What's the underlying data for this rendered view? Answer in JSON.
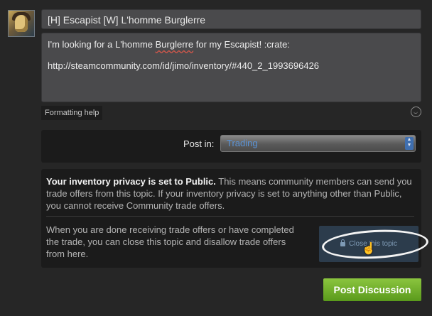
{
  "user": {
    "avatar_icon": "user-avatar"
  },
  "compose": {
    "title_value": "[H] Escapist [W] L'homme Burglerre",
    "body_line1_pre": "I'm looking for a L'homme ",
    "body_line1_misspelled": "Burglerre",
    "body_line1_post": " for my Escapist! :crate:",
    "body_line2": "http://steamcommunity.com/id/jimo/inventory/#440_2_1993696426",
    "formatting_help": "Formatting help",
    "emoticon_icon": "smiley-icon"
  },
  "post_in": {
    "label": "Post in:",
    "selected": "Trading"
  },
  "privacy": {
    "bold": "Your inventory privacy is set to Public.",
    "rest": " This means community members can send you trade offers from this topic. If your inventory privacy is set to anything other than Public, you cannot receive Community trade offers.",
    "close_text": "When you are done receiving trade offers or have completed the trade, you can close this topic and disallow trade offers from here.",
    "close_button": "Close this topic"
  },
  "actions": {
    "submit_label": "Post Discussion"
  },
  "colors": {
    "background": "#262626",
    "submit_green": "#6fb02c",
    "select_text": "#5a93d6"
  }
}
